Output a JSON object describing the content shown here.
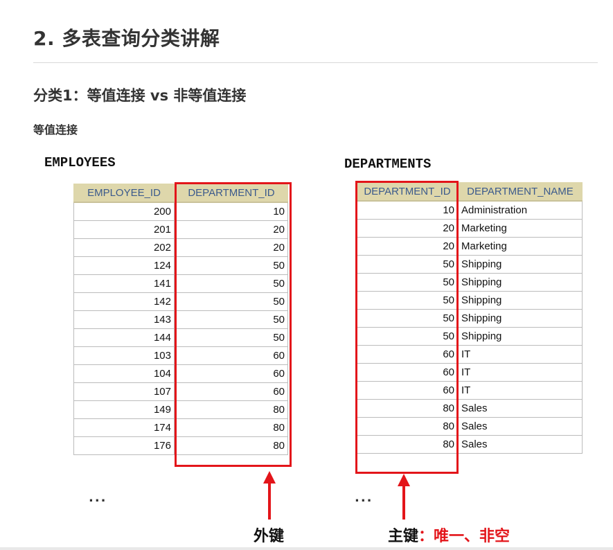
{
  "heading": "2. 多表查询分类讲解",
  "subheading": "分类1：等值连接 vs 非等值连接",
  "subsubheading": "等值连接",
  "employees": {
    "caption": "EMPLOYEES",
    "columns": [
      "EMPLOYEE_ID",
      "DEPARTMENT_ID"
    ],
    "rows": [
      [
        "200",
        "10"
      ],
      [
        "201",
        "20"
      ],
      [
        "202",
        "20"
      ],
      [
        "124",
        "50"
      ],
      [
        "141",
        "50"
      ],
      [
        "142",
        "50"
      ],
      [
        "143",
        "50"
      ],
      [
        "144",
        "50"
      ],
      [
        "103",
        "60"
      ],
      [
        "104",
        "60"
      ],
      [
        "107",
        "60"
      ],
      [
        "149",
        "80"
      ],
      [
        "174",
        "80"
      ],
      [
        "176",
        "80"
      ]
    ],
    "ellipsis": "...",
    "arrow_label": "外键"
  },
  "departments": {
    "caption": "DEPARTMENTS",
    "columns": [
      "DEPARTMENT_ID",
      "DEPARTMENT_NAME"
    ],
    "rows": [
      [
        "10",
        "Administration"
      ],
      [
        "20",
        "Marketing"
      ],
      [
        "20",
        "Marketing"
      ],
      [
        "50",
        "Shipping"
      ],
      [
        "50",
        "Shipping"
      ],
      [
        "50",
        "Shipping"
      ],
      [
        "50",
        "Shipping"
      ],
      [
        "50",
        "Shipping"
      ],
      [
        "60",
        "IT"
      ],
      [
        "60",
        "IT"
      ],
      [
        "60",
        "IT"
      ],
      [
        "80",
        "Sales"
      ],
      [
        "80",
        "Sales"
      ],
      [
        "80",
        "Sales"
      ]
    ],
    "ellipsis": "...",
    "arrow_label": "主键",
    "arrow_note": "：唯一、非空"
  },
  "colors": {
    "highlight": "#e3151a",
    "header_bg": "#ded7ab",
    "header_text": "#3b5a8c"
  }
}
